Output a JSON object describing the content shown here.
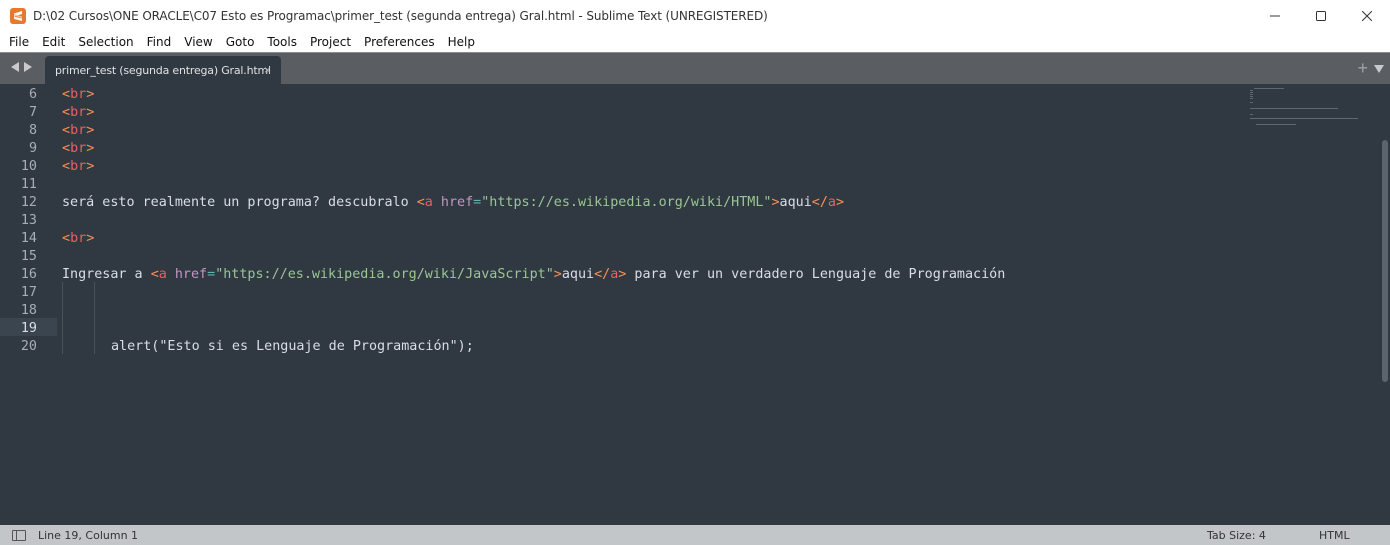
{
  "window": {
    "title": "D:\\02 Cursos\\ONE ORACLE\\C07 Esto es Programac\\primer_test (segunda entrega) Gral.html - Sublime Text (UNREGISTERED)",
    "app_icon": "sublime-text-icon",
    "controls": [
      "minimize-icon",
      "maximize-icon",
      "close-icon"
    ]
  },
  "menu": {
    "items": [
      "File",
      "Edit",
      "Selection",
      "Find",
      "View",
      "Goto",
      "Tools",
      "Project",
      "Preferences",
      "Help"
    ]
  },
  "tabs": {
    "active": {
      "label": "primer_test (segunda entrega) Gral.html",
      "close_glyph": "×"
    },
    "new_tab_glyph": "+"
  },
  "editor": {
    "current_line": 19,
    "line_numbers": [
      "6",
      "7",
      "8",
      "9",
      "10",
      "11",
      "12",
      "13",
      "14",
      "15",
      "16",
      "17",
      "18",
      "19",
      "20"
    ],
    "lines": {
      "l6": "br",
      "l7": "br",
      "l8": "br",
      "l9": "br",
      "l10": "br",
      "l12": {
        "text": "será esto realmente un programa? descubralo ",
        "attr": "href",
        "value": "\"https://es.wikipedia.org/wiki/HTML\"",
        "link_text": "aqui"
      },
      "l14": "br",
      "l16": {
        "text": "Ingresar a ",
        "attr": "href",
        "value": "\"https://es.wikipedia.org/wiki/JavaScript\"",
        "link_text": "aqui",
        "after": " para ver un verdadero Lenguaje de Programación"
      },
      "l20": "alert(\"Esto si es Lenguaje de Programación\");"
    },
    "colors": {
      "background": "#303841",
      "punctuation": "#f99157",
      "tag": "#ec5f66",
      "attribute": "#c594c5",
      "string": "#99c794",
      "text": "#d8dee9"
    }
  },
  "status": {
    "position": "Line 19, Column 1",
    "tab_size": "Tab Size: 4",
    "syntax": "HTML"
  }
}
